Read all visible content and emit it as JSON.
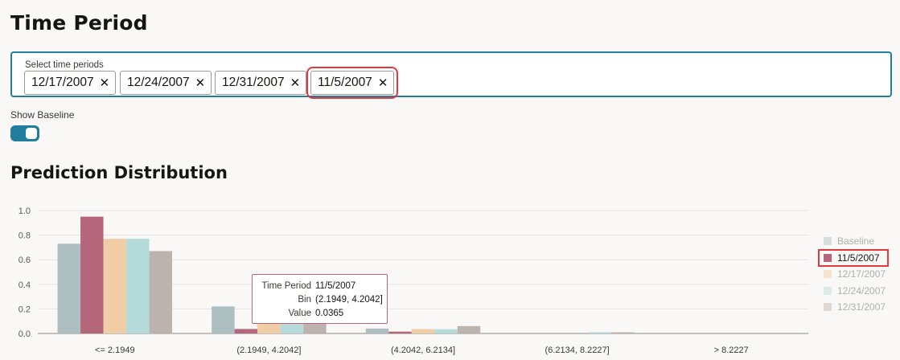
{
  "page": {
    "title": "Time Period",
    "section_title": "Prediction Distribution"
  },
  "time_picker": {
    "label": "Select time periods",
    "chips": [
      {
        "label": "12/17/2007",
        "remove_icon": "close-icon"
      },
      {
        "label": "12/24/2007",
        "remove_icon": "close-icon"
      },
      {
        "label": "12/31/2007",
        "remove_icon": "close-icon"
      },
      {
        "label": "11/5/2007",
        "remove_icon": "close-icon",
        "highlighted": true
      }
    ]
  },
  "baseline_toggle": {
    "label": "Show Baseline",
    "on": true
  },
  "colors": {
    "accent": "#227e9e",
    "highlight_box": "#e0393e"
  },
  "chart_data": {
    "type": "bar",
    "categories": [
      "<= 2.1949",
      "(2.1949, 4.2042]",
      "(4.2042, 6.2134]",
      "(6.2134, 8.2227]",
      "> 8.2227"
    ],
    "ylim": [
      0,
      1.0
    ],
    "yticks": [
      "0.0",
      "0.2",
      "0.4",
      "0.6",
      "0.8",
      "1.0"
    ],
    "grid": true,
    "legend_position": "right",
    "series": [
      {
        "name": "Baseline",
        "color": "#aebfc1",
        "values": [
          0.73,
          0.22,
          0.04,
          0.0,
          0.0
        ]
      },
      {
        "name": "11/5/2007",
        "color": "#b5667a",
        "values": [
          0.95,
          0.0365,
          0.015,
          0.0,
          0.0
        ]
      },
      {
        "name": "12/17/2007",
        "color": "#f0cda4",
        "values": [
          0.77,
          0.11,
          0.035,
          0.0,
          0.0
        ]
      },
      {
        "name": "12/24/2007",
        "color": "#b4dbd9",
        "values": [
          0.77,
          0.1,
          0.035,
          0.01,
          0.0
        ]
      },
      {
        "name": "12/31/2007",
        "color": "#bdb3ae",
        "values": [
          0.67,
          0.14,
          0.06,
          0.01,
          0.0
        ]
      }
    ],
    "legend": [
      {
        "name": "Baseline",
        "active": false
      },
      {
        "name": "11/5/2007",
        "active": true,
        "highlighted": true
      },
      {
        "name": "12/17/2007",
        "active": false
      },
      {
        "name": "12/24/2007",
        "active": false
      },
      {
        "name": "12/31/2007",
        "active": false
      }
    ],
    "tooltip": {
      "rows": [
        {
          "key": "Time Period",
          "value": "11/5/2007"
        },
        {
          "key": "Bin",
          "value": "(2.1949, 4.2042]"
        },
        {
          "key": "Value",
          "value": "0.0365"
        }
      ]
    }
  }
}
